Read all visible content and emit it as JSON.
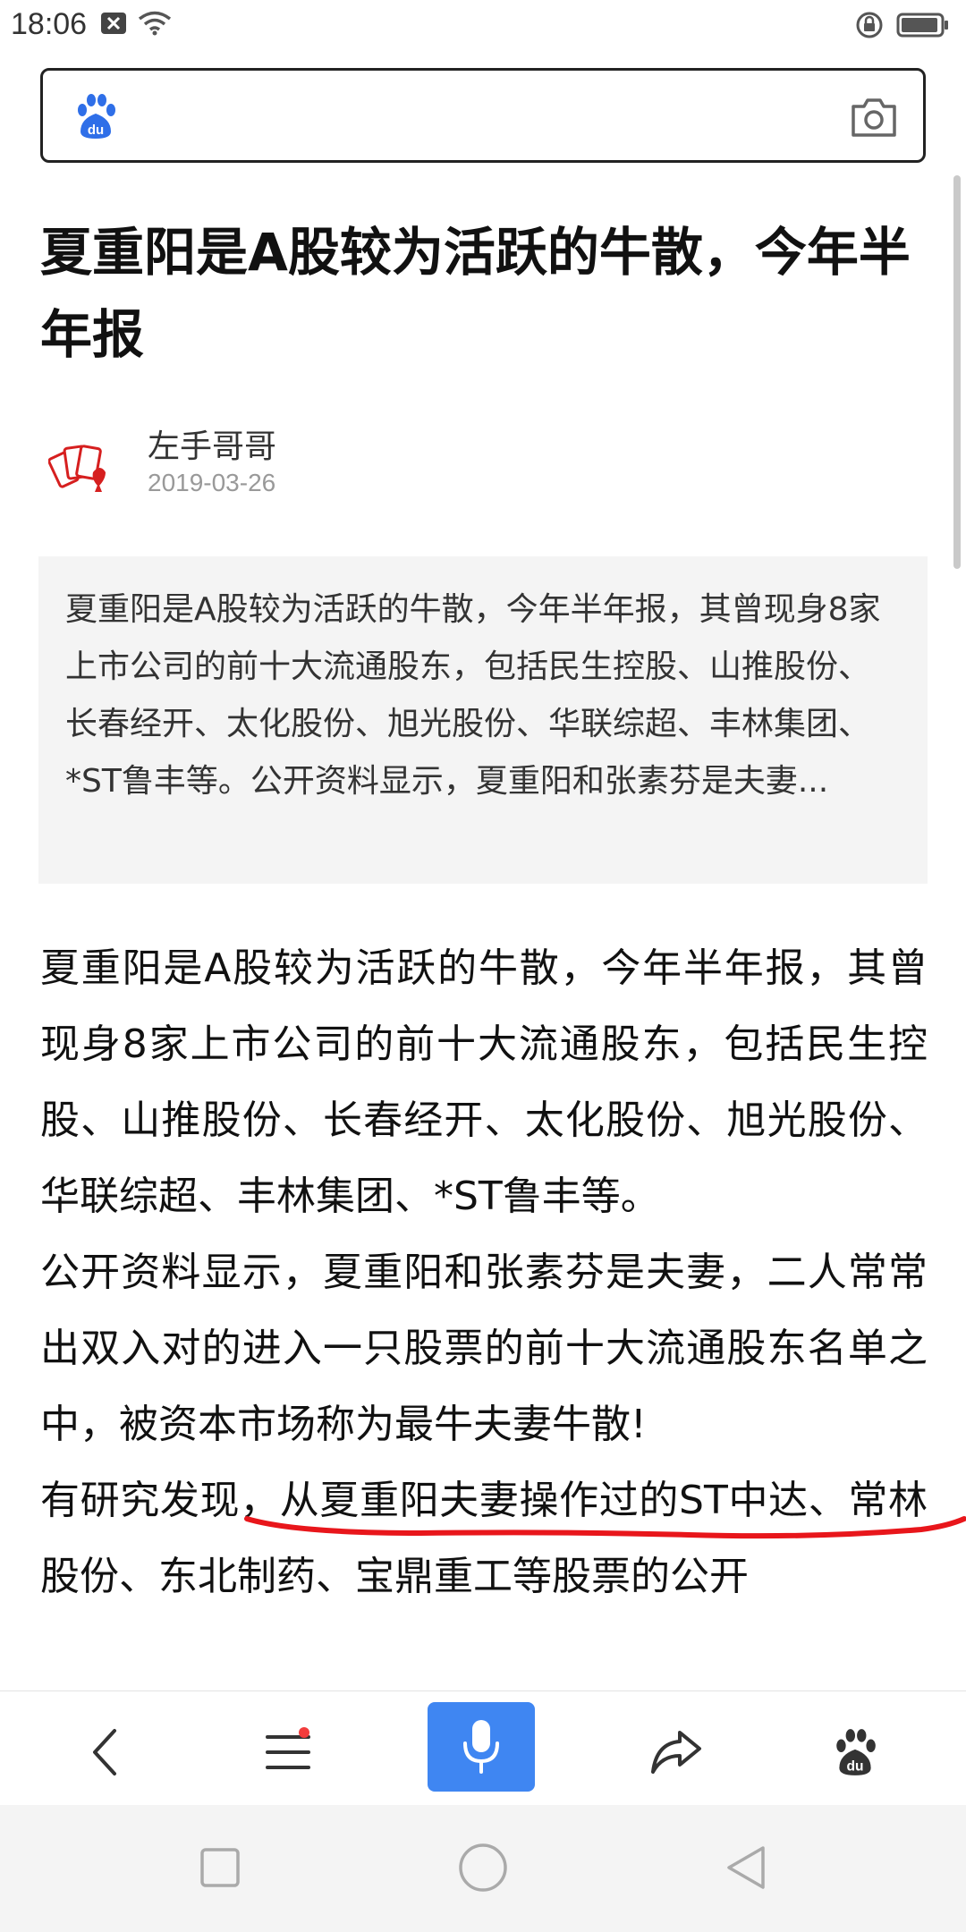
{
  "status_bar": {
    "time": "18:06"
  },
  "search": {
    "placeholder": ""
  },
  "article": {
    "title": "夏重阳是A股较为活跃的牛散，今年半年报",
    "author": "左手哥哥",
    "date": "2019-03-26",
    "summary": "夏重阳是A股较为活跃的牛散，今年半年报，其曾现身8家上市公司的前十大流通股东，包括民生控股、山推股份、长春经开、太化股份、旭光股份、华联综超、丰林集团、*ST鲁丰等。公开资料显示，夏重阳和张素芬是夫妻...",
    "paragraphs": [
      "夏重阳是A股较为活跃的牛散，今年半年报，其曾现身8家上市公司的前十大流通股东，包括民生控股、山推股份、长春经开、太化股份、旭光股份、华联综超、丰林集团、*ST鲁丰等。",
      "公开资料显示，夏重阳和张素芬是夫妻，二人常常出双入对的进入一只股票的前十大流通股东名单之中，被资本市场称为最牛夫妻牛散!",
      "有研究发现，从夏重阳夫妻操作过的ST中达、常林股份、东北制药、宝鼎重工等股票的公开"
    ]
  },
  "colors": {
    "accent": "#3f86f2",
    "badge": "#f23c3c",
    "annotation": "#e8161b"
  },
  "icons": {
    "search_logo": "baidu-paw-icon",
    "camera": "camera-icon",
    "back": "back-arrow-icon",
    "menu": "menu-icon",
    "voice": "microphone-icon",
    "share": "share-icon",
    "home": "baidu-paw-icon"
  }
}
